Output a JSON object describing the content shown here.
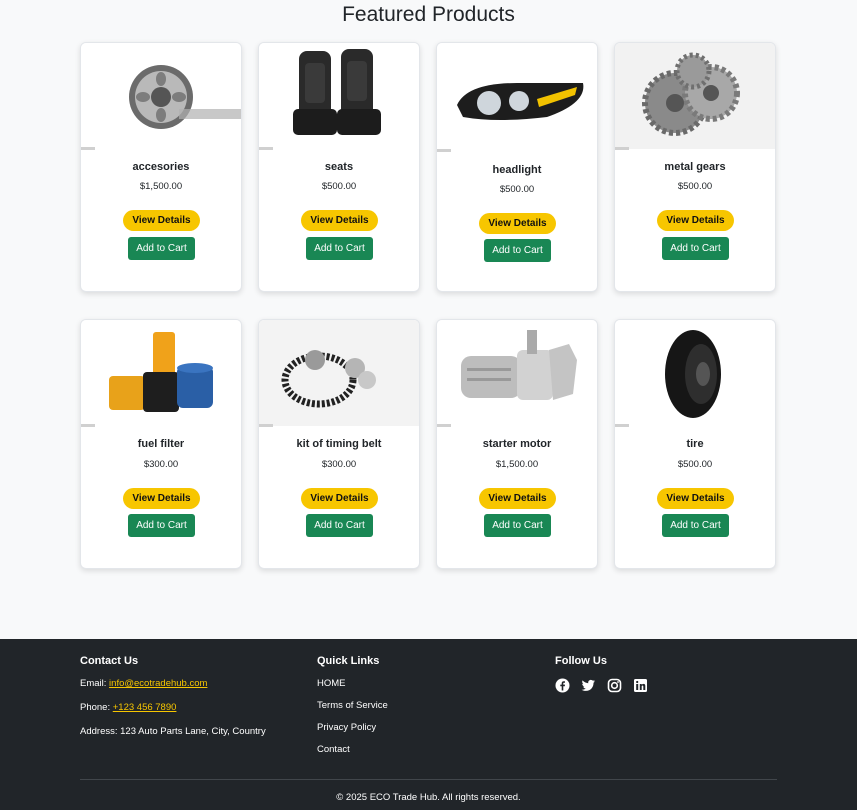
{
  "page_title": "Featured Products",
  "products": [
    {
      "name": "accesories",
      "price": "$1,500.00",
      "image": "wheel-rim-image"
    },
    {
      "name": "seats",
      "price": "$500.00",
      "image": "car-seats-image"
    },
    {
      "name": "headlight",
      "price": "$500.00",
      "image": "headlight-image"
    },
    {
      "name": "metal gears",
      "price": "$500.00",
      "image": "metal-gears-image"
    },
    {
      "name": "fuel filter",
      "price": "$300.00",
      "image": "fuel-filter-image"
    },
    {
      "name": "kit of timing belt",
      "price": "$300.00",
      "image": "timing-belt-image"
    },
    {
      "name": "starter motor",
      "price": "$1,500.00",
      "image": "starter-motor-image"
    },
    {
      "name": "tire",
      "price": "$500.00",
      "image": "tire-image"
    }
  ],
  "buttons": {
    "view_details": "View Details",
    "add_to_cart": "Add to Cart"
  },
  "footer": {
    "contact": {
      "heading": "Contact Us",
      "email_label": "Email: ",
      "email": "info@ecotradehub.com",
      "phone_label": "Phone: ",
      "phone": "+123 456 7890",
      "address": "Address: 123 Auto Parts Lane, City, Country"
    },
    "quick_links": {
      "heading": "Quick Links",
      "items": [
        "HOME",
        "Terms of Service",
        "Privacy Policy",
        "Contact"
      ]
    },
    "follow": {
      "heading": "Follow Us",
      "icons": [
        "facebook-icon",
        "twitter-icon",
        "instagram-icon",
        "linkedin-icon"
      ]
    },
    "copyright": "© 2025 ECO Trade Hub. All rights reserved."
  },
  "colors": {
    "accent_yellow": "#f7c600",
    "cart_green": "#198754",
    "footer_bg": "#212529",
    "page_bg": "#f8f9fa"
  }
}
